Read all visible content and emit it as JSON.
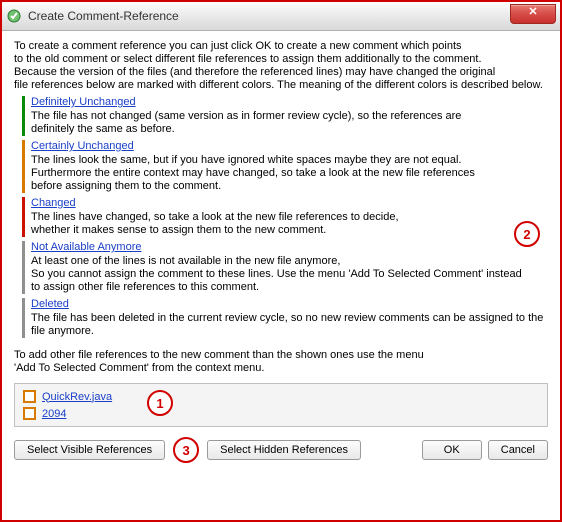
{
  "window": {
    "title": "Create Comment-Reference"
  },
  "intro": {
    "l1": "To create a comment reference you can just click OK to create a new comment which points",
    "l2": "to the old comment or select different file references to assign them additionally to the comment.",
    "l3": "Because the version of the files (and therefore the referenced lines) may have changed the original",
    "l4": "file references below are marked with different colors. The meaning of the different colors is described below."
  },
  "categories": {
    "defUnchanged": {
      "title": "Definitely Unchanged",
      "l1": "The file has not changed (same version as in former review cycle), so the references are",
      "l2": "definitely the same as before."
    },
    "certUnchanged": {
      "title": "Certainly Unchanged",
      "l1": "The lines look the same, but if you have ignored white spaces maybe they are not equal.",
      "l2": "Furthermore the entire context may have changed, so take a look at the new file references",
      "l3": "before assigning them to the comment."
    },
    "changed": {
      "title": "Changed",
      "l1": "The lines have changed, so take a look at the new file references to decide,",
      "l2": "whether it makes sense to assign them to the new comment."
    },
    "notAvail": {
      "title": "Not Available Anymore",
      "l1": "At least one of the lines is not available in the new file anymore,",
      "l2": "So you cannot assign the comment to these lines. Use the menu 'Add To Selected Comment' instead",
      "l3": "to assign other file references to this comment."
    },
    "deleted": {
      "title": "Deleted",
      "l1": "The file has been deleted in the current review cycle, so no new review comments can be assigned to the",
      "l2": "file anymore."
    }
  },
  "menuHint": {
    "l1": "To add other file references to the new comment than the shown ones use the menu",
    "l2": "'Add To Selected Comment' from the context menu."
  },
  "refs": {
    "0": {
      "label": "QuickRev.java"
    },
    "1": {
      "label": "2094"
    }
  },
  "buttons": {
    "selectVisible": "Select Visible References",
    "selectHidden": "Select Hidden References",
    "ok": "OK",
    "cancel": "Cancel"
  },
  "callouts": {
    "c1": "1",
    "c2": "2",
    "c3": "3"
  }
}
